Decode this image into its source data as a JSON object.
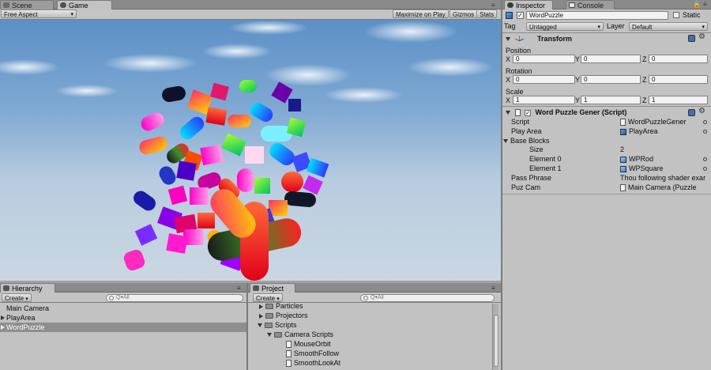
{
  "tabs": {
    "scene": "Scene",
    "game": "Game",
    "inspector": "Inspector",
    "console": "Console",
    "hierarchy": "Hierarchy",
    "project": "Project"
  },
  "game_toolbar": {
    "aspect": "Free Aspect",
    "maximize": "Maximize on Play",
    "gizmos": "Gizmos",
    "stats": "Stats"
  },
  "inspector": {
    "object_name": "WordPuzzle",
    "static_label": "Static",
    "tag_label": "Tag",
    "tag_value": "Untagged",
    "layer_label": "Layer",
    "layer_value": "Default",
    "transform": {
      "title": "Transform",
      "position_label": "Position",
      "position": {
        "x": "0",
        "y": "0",
        "z": "0"
      },
      "rotation_label": "Rotation",
      "rotation": {
        "x": "0",
        "y": "0",
        "z": "0"
      },
      "scale_label": "Scale",
      "scale": {
        "x": "1",
        "y": "1",
        "z": "1"
      },
      "x": "X",
      "y": "Y",
      "z": "Z"
    },
    "script_component": {
      "title": "Word Puzzle Gener (Script)",
      "script_label": "Script",
      "script_value": "WordPuzzleGener",
      "play_area_label": "Play Area",
      "play_area_value": "PlayArea",
      "base_blocks_label": "Base Blocks",
      "size_label": "Size",
      "size_value": "2",
      "element0_label": "Element 0",
      "element0_value": "WPRod",
      "element1_label": "Element 1",
      "element1_value": "WPSquare",
      "pass_phrase_label": "Pass Phrase",
      "pass_phrase_value": "Thou following shader exar",
      "puz_cam_label": "Puz Cam",
      "puz_cam_value": "Main Camera (Puzzle"
    }
  },
  "hierarchy": {
    "create": "Create",
    "search_placeholder": "Q▾All",
    "items": [
      "Main Camera",
      "PlayArea",
      "WordPuzzle"
    ]
  },
  "project": {
    "create": "Create",
    "search_placeholder": "Q▾All",
    "items": [
      "Particles",
      "Projectors",
      "Scripts",
      "Camera Scripts",
      "MouseOrbit",
      "SmoothFollow",
      "SmoothLookAt"
    ]
  },
  "colors": {
    "panel_bg": "#c2c2c2",
    "selected_row": "#8e8e8e",
    "sky_top": "#5d92c9",
    "sky_bottom": "#c9d6e2"
  }
}
